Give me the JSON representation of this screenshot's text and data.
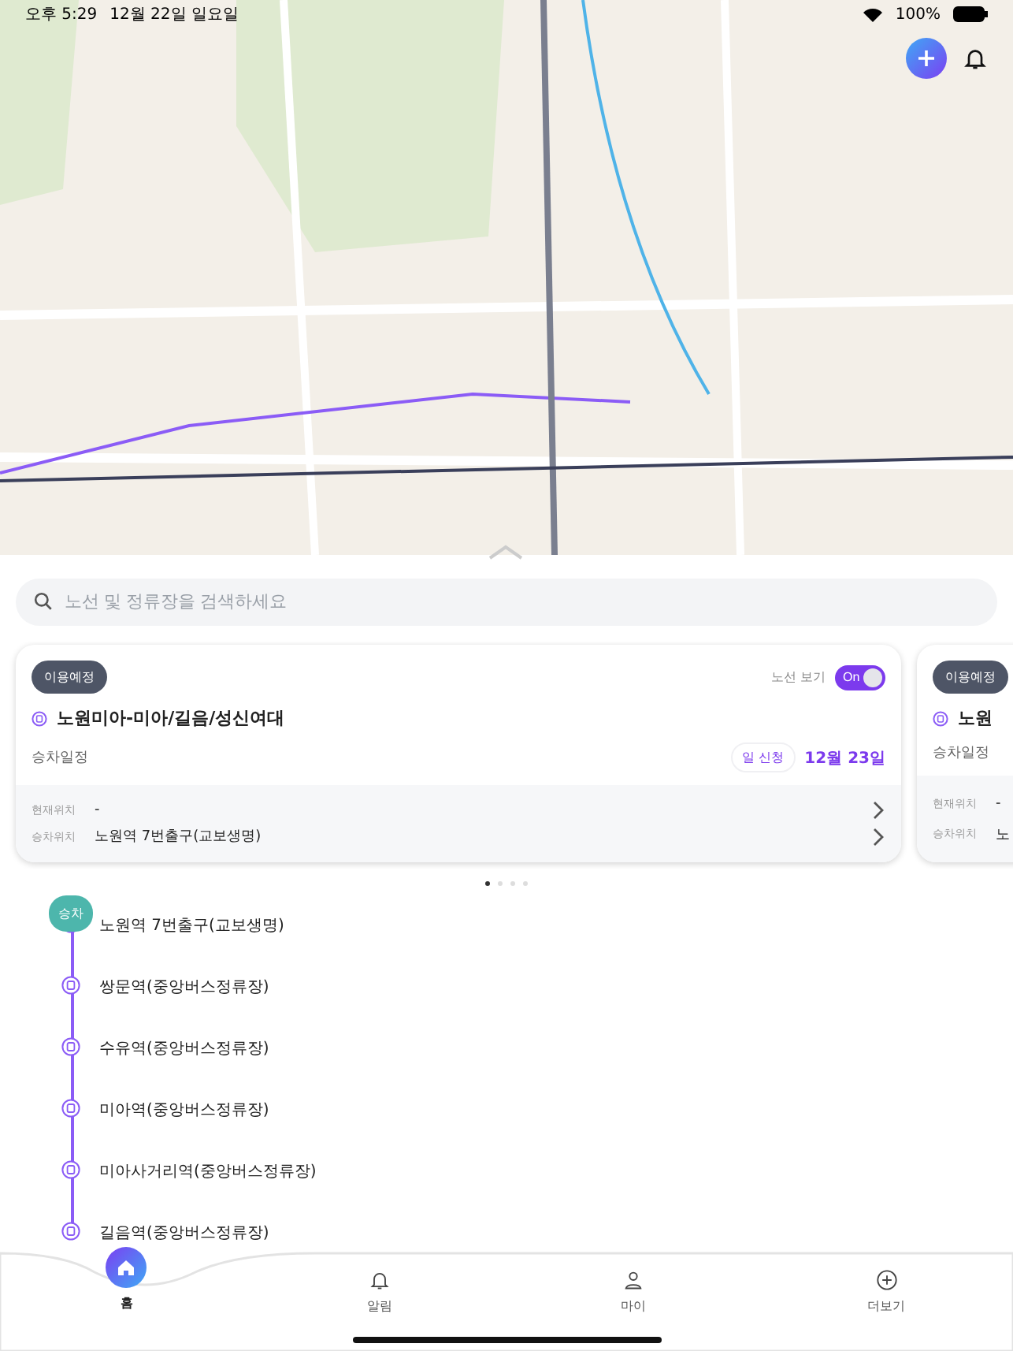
{
  "status_bar": {
    "time": "오후 5:29",
    "date": "12월 22일 일요일",
    "battery": "100%"
  },
  "search": {
    "placeholder": "노선 및 정류장을 검색하세요"
  },
  "cards": [
    {
      "badge": "이용예정",
      "route_toggle": {
        "label": "노선 보기",
        "text": "On",
        "on": true
      },
      "route": "노원미아-미아/길음/성신여대",
      "schedule_label": "승차일정",
      "request_tag": "일 신청",
      "date": "12월 23일",
      "current_label": "현재위치",
      "current_value": "-",
      "boarding_label": "승차위치",
      "boarding_value": "노원역 7번출구(교보생명)"
    },
    {
      "badge": "이용예정",
      "route": "노원",
      "schedule_label": "승차일정",
      "current_label": "현재위치",
      "current_value": "-",
      "boarding_label": "승차위치",
      "boarding_value": "노"
    }
  ],
  "page_dots": [
    {
      "selected": true
    },
    {
      "selected": false
    },
    {
      "selected": false
    },
    {
      "selected": false
    }
  ],
  "stops": [
    {
      "name": "노원역 7번출구(교보생명)",
      "tag": "승차"
    },
    {
      "name": "쌍문역(중앙버스정류장)"
    },
    {
      "name": "수유역(중앙버스정류장)"
    },
    {
      "name": "미아역(중앙버스정류장)"
    },
    {
      "name": "미아사거리역(중앙버스정류장)"
    },
    {
      "name": "길음역(중앙버스정류장)"
    }
  ],
  "nav": [
    {
      "label": "홈",
      "kind": "home",
      "selected": true
    },
    {
      "label": "알림",
      "kind": "bell",
      "selected": false
    },
    {
      "label": "마이",
      "kind": "person",
      "selected": false
    },
    {
      "label": "더보기",
      "kind": "more",
      "selected": false
    }
  ]
}
